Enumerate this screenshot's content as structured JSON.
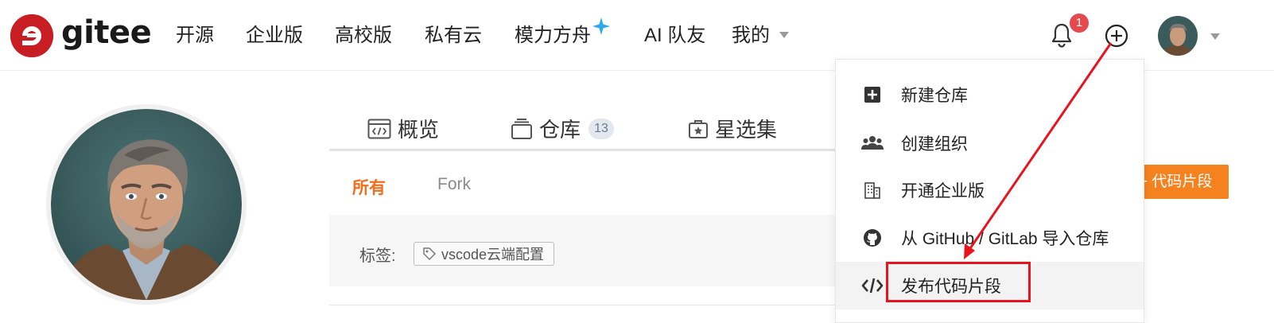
{
  "header": {
    "brand": "gitee",
    "nav": [
      "开源",
      "企业版",
      "高校版",
      "私有云",
      "模力方舟",
      "AI 队友",
      "我的"
    ],
    "notification_count": "1"
  },
  "tabs": [
    {
      "label": "概览",
      "icon": "code-window-icon"
    },
    {
      "label": "仓库",
      "count": "13",
      "icon": "repo-stack-icon"
    },
    {
      "label": "星选集",
      "icon": "star-box-icon"
    }
  ],
  "filters": {
    "all": "所有",
    "fork": "Fork"
  },
  "tag_section": {
    "label": "标签:",
    "tag": "vscode云端配置"
  },
  "action_button": "+ 代码片段",
  "dropdown": {
    "items": [
      {
        "label": "新建仓库",
        "icon": "plus-square-icon"
      },
      {
        "label": "创建组织",
        "icon": "users-icon"
      },
      {
        "label": "开通企业版",
        "icon": "building-icon"
      },
      {
        "label": "从 GitHub / GitLab 导入仓库",
        "icon": "github-icon"
      },
      {
        "label": "发布代码片段",
        "icon": "code-icon"
      }
    ]
  },
  "colors": {
    "brand_red": "#c71d23",
    "accent_orange": "#f26d1c",
    "button_orange": "#f5811f",
    "annotation_red": "#e8141d",
    "badge_red": "#e5484d"
  }
}
